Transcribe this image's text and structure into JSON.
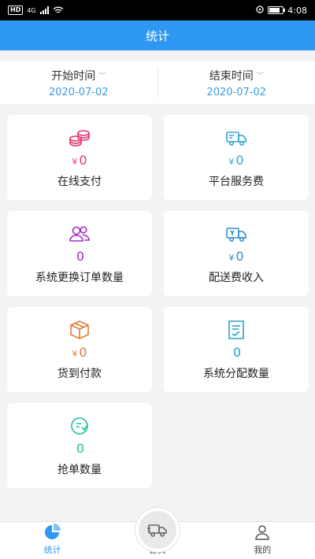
{
  "status_bar": {
    "left_badge": "HD",
    "network": "4G",
    "time": "4:08"
  },
  "header": {
    "title": "统计"
  },
  "date_filter": {
    "start": {
      "label": "开始时间",
      "value": "2020-07-02"
    },
    "end": {
      "label": "结束时间",
      "value": "2020-07-02"
    }
  },
  "stats": [
    {
      "icon": "coin-stack-icon",
      "currency": "¥",
      "value": "0",
      "label": "在线支付",
      "color": "#e8356a"
    },
    {
      "icon": "delivery-truck-icon",
      "currency": "¥",
      "value": "0",
      "label": "平台服务费",
      "color": "#2fa7d8"
    },
    {
      "icon": "users-icon",
      "currency": "",
      "value": "0",
      "label": "系统更换订单数量",
      "color": "#a62bc9"
    },
    {
      "icon": "delivery-van-icon",
      "currency": "¥",
      "value": "0",
      "label": "配送费收入",
      "color": "#2f8fd0"
    },
    {
      "icon": "package-box-icon",
      "currency": "¥",
      "value": "0",
      "label": "货到付款",
      "color": "#e07a36"
    },
    {
      "icon": "checklist-icon",
      "currency": "",
      "value": "0",
      "label": "系统分配数量",
      "color": "#22a3c4"
    },
    {
      "icon": "grab-order-icon",
      "currency": "",
      "value": "0",
      "label": "抢单数量",
      "color": "#1bbfa0"
    }
  ],
  "tabs": [
    {
      "icon": "pie-chart-icon",
      "label": "统计",
      "active": true
    },
    {
      "icon": "truck-icon",
      "label": "首页",
      "active": false
    },
    {
      "icon": "user-icon",
      "label": "我的",
      "active": false
    }
  ],
  "colors": {
    "primary": "#2f98f2",
    "date_value": "#3a9be0",
    "background": "#f3f3f5"
  }
}
